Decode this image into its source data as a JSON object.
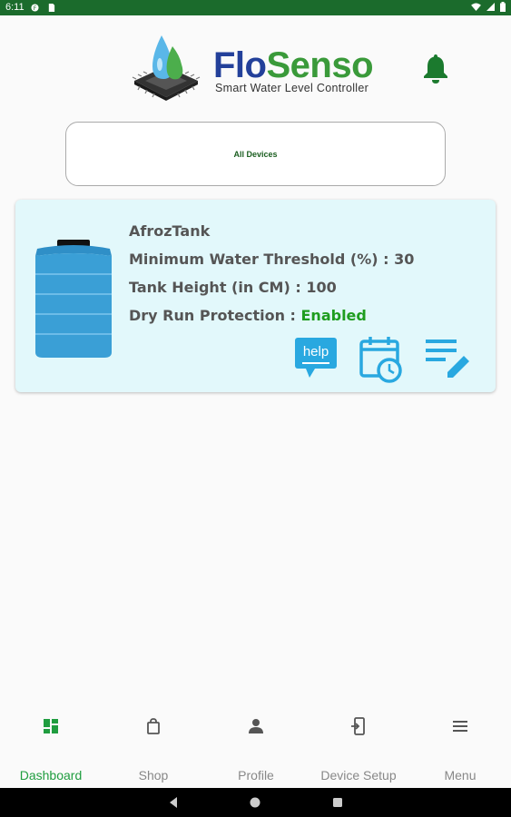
{
  "status_bar": {
    "time": "6:11"
  },
  "app": {
    "brand_part1": "Flo",
    "brand_part2": "Senso",
    "tagline": "Smart Water Level Controller"
  },
  "devices_selector": {
    "label": "All Devices"
  },
  "device_card": {
    "name": "AfrozTank",
    "threshold_label": "Minimum Water Threshold (%) : ",
    "threshold_value": "30",
    "height_label": "Tank Height (in CM) : ",
    "height_value": "100",
    "dry_run_label": "Dry Run Protection : ",
    "dry_run_value": "Enabled",
    "help_text": "help"
  },
  "bottom_nav": [
    {
      "label": "Dashboard",
      "icon": "dashboard-icon",
      "active": true
    },
    {
      "label": "Shop",
      "icon": "shopping-bag-icon",
      "active": false
    },
    {
      "label": "Profile",
      "icon": "person-icon",
      "active": false
    },
    {
      "label": "Device Setup",
      "icon": "phone-setup-icon",
      "active": false
    },
    {
      "label": "Menu",
      "icon": "menu-icon",
      "active": false
    }
  ],
  "colors": {
    "status_bar": "#1b6b2c",
    "brand_blue": "#23409a",
    "brand_green": "#3a9a3a",
    "card_bg": "#e2f8fb",
    "action_icons": "#29a8e0",
    "enabled_green": "#1f9d1f",
    "active_nav": "#1f9d3f"
  }
}
